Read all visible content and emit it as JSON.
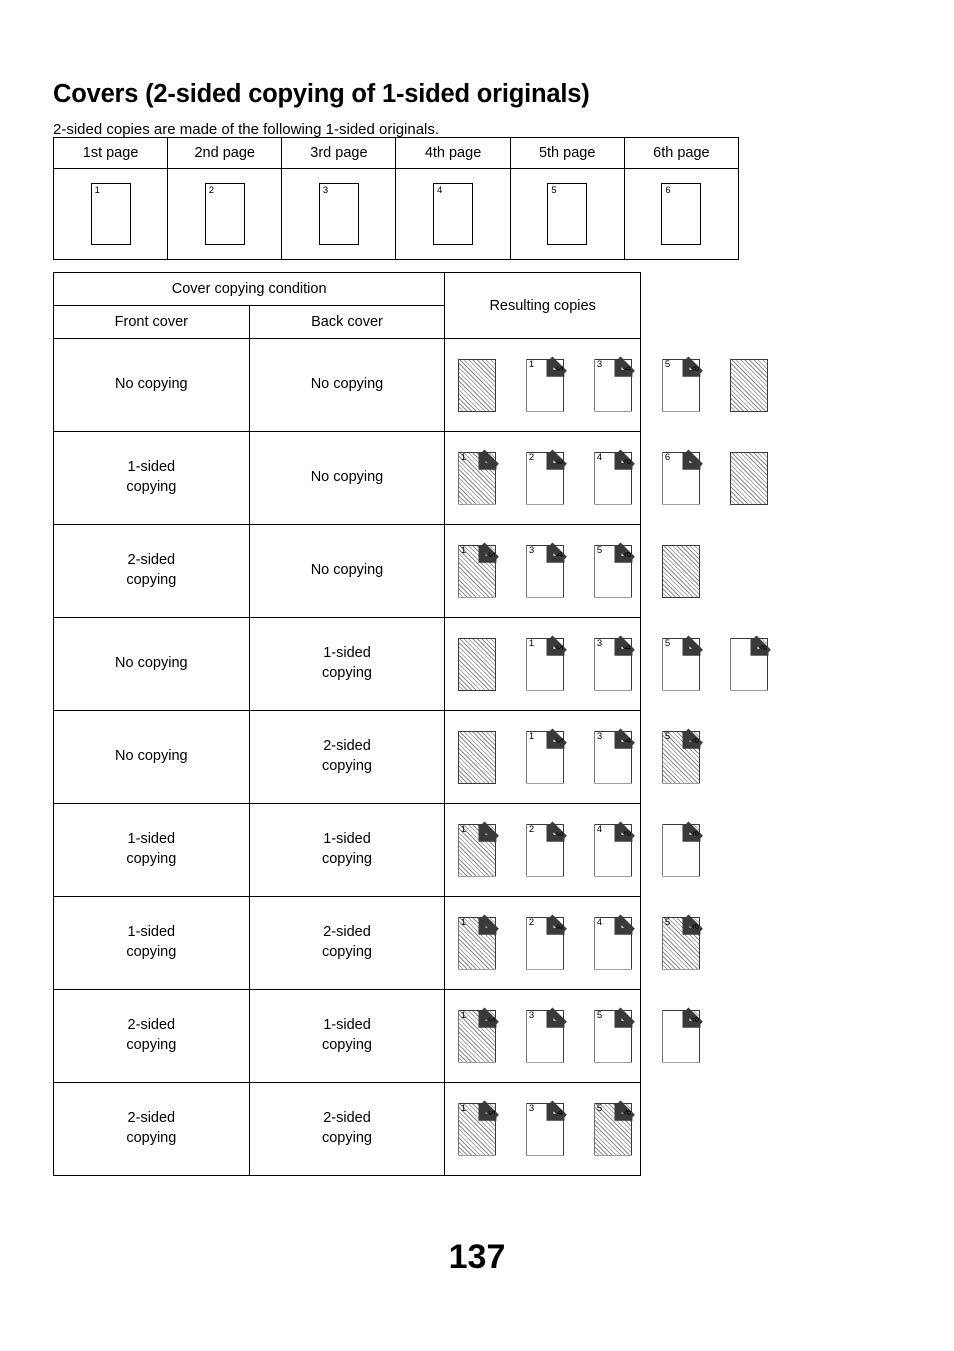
{
  "document": {
    "title": "Covers (2-sided copying of 1-sided originals)",
    "subtitle": "2-sided copies are made of the following 1-sided originals.",
    "page_number": "137"
  },
  "originals_table": {
    "headers": [
      "1st page",
      "2nd page",
      "3rd page",
      "4th page",
      "5th page",
      "6th page"
    ],
    "sheets": [
      {
        "number": "1"
      },
      {
        "number": "2"
      },
      {
        "number": "3"
      },
      {
        "number": "4"
      },
      {
        "number": "5"
      },
      {
        "number": "6"
      }
    ]
  },
  "conditions_table": {
    "group_header": "Cover copying condition",
    "headers": {
      "front_cover": "Front cover",
      "back_cover": "Back cover",
      "resulting_copies": "Resulting copies"
    },
    "rows": [
      {
        "front_cover": "No copying",
        "back_cover": "No copying",
        "sheets": [
          {
            "style": "blank-hatched"
          },
          {
            "style": "folded",
            "front": "1",
            "back": "2"
          },
          {
            "style": "folded",
            "front": "3",
            "back": "4"
          },
          {
            "style": "folded",
            "front": "5",
            "back": "6"
          },
          {
            "style": "blank-hatched"
          }
        ]
      },
      {
        "front_cover": "1-sided\ncopying",
        "back_cover": "No copying",
        "sheets": [
          {
            "style": "folded-hatched",
            "front": "1",
            "back": ""
          },
          {
            "style": "folded",
            "front": "2",
            "back": "3"
          },
          {
            "style": "folded",
            "front": "4",
            "back": "5"
          },
          {
            "style": "folded",
            "front": "6",
            "back": ""
          },
          {
            "style": "blank-hatched"
          }
        ]
      },
      {
        "front_cover": "2-sided\ncopying",
        "back_cover": "No copying",
        "sheets": [
          {
            "style": "folded-hatched",
            "front": "1",
            "back": "2"
          },
          {
            "style": "folded",
            "front": "3",
            "back": "4"
          },
          {
            "style": "folded",
            "front": "5",
            "back": "6"
          },
          {
            "style": "blank-hatched"
          }
        ]
      },
      {
        "front_cover": "No copying",
        "back_cover": "1-sided\ncopying",
        "sheets": [
          {
            "style": "blank-hatched"
          },
          {
            "style": "folded",
            "front": "1",
            "back": "2"
          },
          {
            "style": "folded",
            "front": "3",
            "back": "4"
          },
          {
            "style": "folded",
            "front": "5",
            "back": ""
          },
          {
            "style": "folded-foldhatch",
            "front": "",
            "back": "6"
          }
        ]
      },
      {
        "front_cover": "No copying",
        "back_cover": "2-sided\ncopying",
        "sheets": [
          {
            "style": "blank-hatched"
          },
          {
            "style": "folded",
            "front": "1",
            "back": "2"
          },
          {
            "style": "folded",
            "front": "3",
            "back": "4"
          },
          {
            "style": "folded-hatched",
            "front": "5",
            "back": "6"
          }
        ]
      },
      {
        "front_cover": "1-sided\ncopying",
        "back_cover": "1-sided\ncopying",
        "sheets": [
          {
            "style": "folded-hatched",
            "front": "1",
            "back": ""
          },
          {
            "style": "folded",
            "front": "2",
            "back": "3"
          },
          {
            "style": "folded",
            "front": "4",
            "back": "5"
          },
          {
            "style": "folded-foldhatch",
            "front": "",
            "back": "6"
          }
        ]
      },
      {
        "front_cover": "1-sided\ncopying",
        "back_cover": "2-sided\ncopying",
        "sheets": [
          {
            "style": "folded-hatched",
            "front": "1",
            "back": ""
          },
          {
            "style": "folded",
            "front": "2",
            "back": "3"
          },
          {
            "style": "folded",
            "front": "4",
            "back": ""
          },
          {
            "style": "folded-hatched",
            "front": "5",
            "back": "6"
          }
        ]
      },
      {
        "front_cover": "2-sided\ncopying",
        "back_cover": "1-sided\ncopying",
        "sheets": [
          {
            "style": "folded-hatched",
            "front": "1",
            "back": "2"
          },
          {
            "style": "folded",
            "front": "3",
            "back": ""
          },
          {
            "style": "folded",
            "front": "5",
            "back": ""
          },
          {
            "style": "folded-foldhatch",
            "front": "",
            "back": "6"
          }
        ]
      },
      {
        "front_cover": "2-sided\ncopying",
        "back_cover": "2-sided\ncopying",
        "sheets": [
          {
            "style": "folded-hatched",
            "front": "1",
            "back": "2"
          },
          {
            "style": "folded",
            "front": "3",
            "back": "4"
          },
          {
            "style": "folded-hatched",
            "front": "5",
            "back": "6"
          }
        ]
      }
    ]
  }
}
